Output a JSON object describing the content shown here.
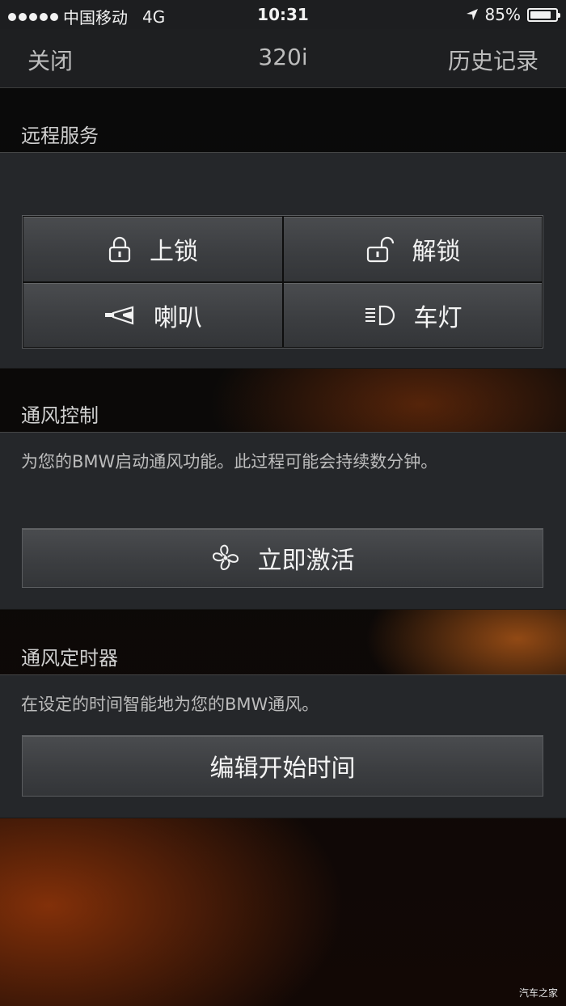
{
  "status_bar": {
    "carrier": "中国移动",
    "network": "4G",
    "time": "10:31",
    "battery_percent": "85%",
    "battery_level": 0.85
  },
  "nav": {
    "close_label": "关闭",
    "title": "320i",
    "history_label": "历史记录"
  },
  "remote_services": {
    "header": "远程服务",
    "buttons": [
      {
        "label": "上锁",
        "icon": "lock-closed-icon"
      },
      {
        "label": "解锁",
        "icon": "lock-open-icon"
      },
      {
        "label": "喇叭",
        "icon": "horn-icon"
      },
      {
        "label": "车灯",
        "icon": "headlight-icon"
      }
    ]
  },
  "ventilation_control": {
    "header": "通风控制",
    "description": "为您的BMW启动通风功能。此过程可能会持续数分钟。",
    "activate_label": "立即激活",
    "activate_icon": "fan-icon"
  },
  "ventilation_timer": {
    "header": "通风定时器",
    "description": "在设定的时间智能地为您的BMW通风。",
    "edit_label": "编辑开始时间"
  },
  "watermark": "汽车之家"
}
